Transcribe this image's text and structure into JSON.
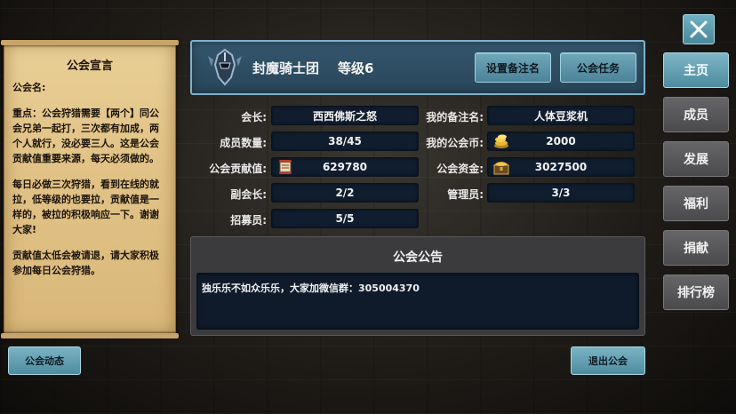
{
  "close": {
    "icon": "close-icon"
  },
  "declaration": {
    "title": "公会宣言",
    "lines": [
      "公会名:",
      "",
      "重点：公会狩猎需要【两个】同公会兄弟一起打，三次都有加成，两个人就行，没必要三人。这是公会贡献值重要来源，每天必须做的。",
      "",
      "每日必做三次狩猎，看到在线的就拉，低等级的也要拉，贡献值是一样的，被拉的积极响应一下。谢谢大家!",
      "",
      "贡献值太低会被请退，请大家积极参加每日公会狩猎。"
    ]
  },
  "header": {
    "emblem_icon": "knight-helmet-emblem-icon",
    "guild_name": "封魔骑士团",
    "level": "等级6",
    "set_note_button": "设置备注名",
    "guild_task_button": "公会任务"
  },
  "info": {
    "leader_label": "会长:",
    "leader_value": "西西佛斯之怒",
    "member_count_label": "成员数量:",
    "member_count_value": "38/45",
    "contribution_label": "公会贡献值:",
    "contribution_value": "629780",
    "contribution_icon": "scroll-icon",
    "vice_leader_label": "副会长:",
    "vice_leader_value": "2/2",
    "recruiter_label": "招募员:",
    "recruiter_value": "5/5",
    "my_note_label": "我的备注名:",
    "my_note_value": "人体豆浆机",
    "my_coin_label": "我的公会币:",
    "my_coin_value": "2000",
    "my_coin_icon": "gold-coins-icon",
    "funds_label": "公会资金:",
    "funds_value": "3027500",
    "funds_icon": "treasure-chest-icon",
    "manager_label": "管理员:",
    "manager_value": "3/3"
  },
  "announcement": {
    "title": "公会公告",
    "text": "独乐乐不如众乐乐，大家加微信群：305004370"
  },
  "nav": {
    "items": [
      {
        "label": "主页",
        "active": true
      },
      {
        "label": "成员",
        "active": false
      },
      {
        "label": "发展",
        "active": false
      },
      {
        "label": "福利",
        "active": false
      },
      {
        "label": "捐献",
        "active": false
      },
      {
        "label": "排行榜",
        "active": false
      }
    ]
  },
  "footer": {
    "guild_activity_button": "公会动态",
    "leave_guild_button": "退出公会"
  },
  "colors": {
    "accent": "#5a97aa",
    "panel": "#2e4c61",
    "field": "#101d2e"
  }
}
